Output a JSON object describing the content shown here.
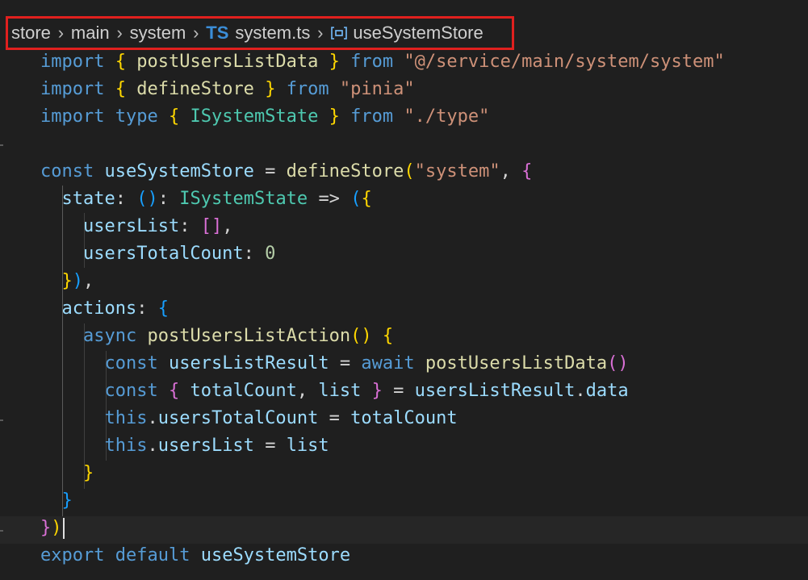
{
  "breadcrumb": {
    "parts": [
      "store",
      "main",
      "system"
    ],
    "file_badge": "TS",
    "file_name": "system.ts",
    "symbol": "useSystemStore"
  },
  "code_lines": [
    "import { postUsersListData } from \"@/service/main/system/system\"",
    "import { defineStore } from \"pinia\"",
    "import type { ISystemState } from \"./type\"",
    "",
    "const useSystemStore = defineStore(\"system\", {",
    "  state: (): ISystemState => ({",
    "    usersList: [],",
    "    usersTotalCount: 0",
    "  }),",
    "  actions: {",
    "    async postUsersListAction() {",
    "      const usersListResult = await postUsersListData()",
    "      const { totalCount, list } = usersListResult.data",
    "      this.usersTotalCount = totalCount",
    "      this.usersList = list",
    "    }",
    "  }",
    "})",
    "export default useSystemStore"
  ],
  "colors": {
    "keyword": "#569cd6",
    "control": "#c586c0",
    "string": "#ce9178",
    "variable": "#9cdcfe",
    "function": "#dcdcaa",
    "type": "#4ec9b0",
    "bracket_gold": "#ffd700",
    "bracket_pink": "#da70d6",
    "bracket_blue": "#179fff",
    "number": "#b5cea8"
  }
}
